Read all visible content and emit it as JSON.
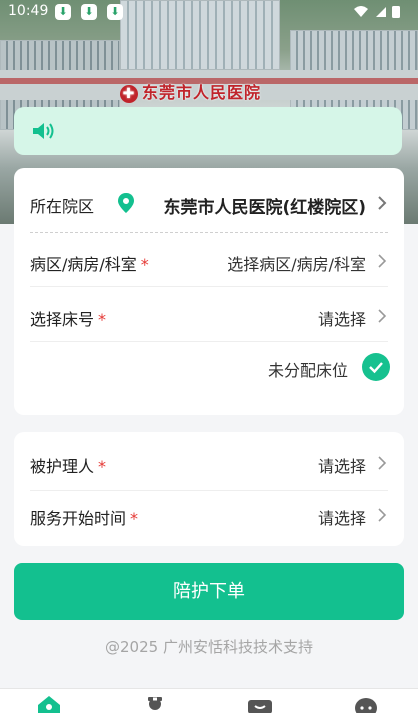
{
  "status_bar": {
    "time": "10:49",
    "download_glyph": "⬇"
  },
  "hero": {
    "sign_text": "东莞市人民医院",
    "cross_glyph": "✚"
  },
  "notice": {
    "icon": "speaker-icon"
  },
  "location": {
    "label": "所在院区",
    "value": "东莞市人民医院(红楼院区)"
  },
  "ward": {
    "label": "病区/病房/科室",
    "value": "选择病区/病房/科室"
  },
  "bed": {
    "label": "选择床号",
    "value": "请选择"
  },
  "unassigned": {
    "label": "未分配床位",
    "checked": true
  },
  "patient": {
    "label": "被护理人",
    "value": "请选择"
  },
  "start_time": {
    "label": "服务开始时间",
    "value": "请选择"
  },
  "required_mark": "*",
  "submit": {
    "label": "陪护下单"
  },
  "footer": {
    "text": "@2025 广州安恬科技技术支持"
  },
  "tabs": [
    "home-icon",
    "nurse-icon",
    "order-icon",
    "profile-icon"
  ],
  "colors": {
    "accent": "#13c08f",
    "notice_bg": "#d6f6e8",
    "required": "#e53935"
  }
}
